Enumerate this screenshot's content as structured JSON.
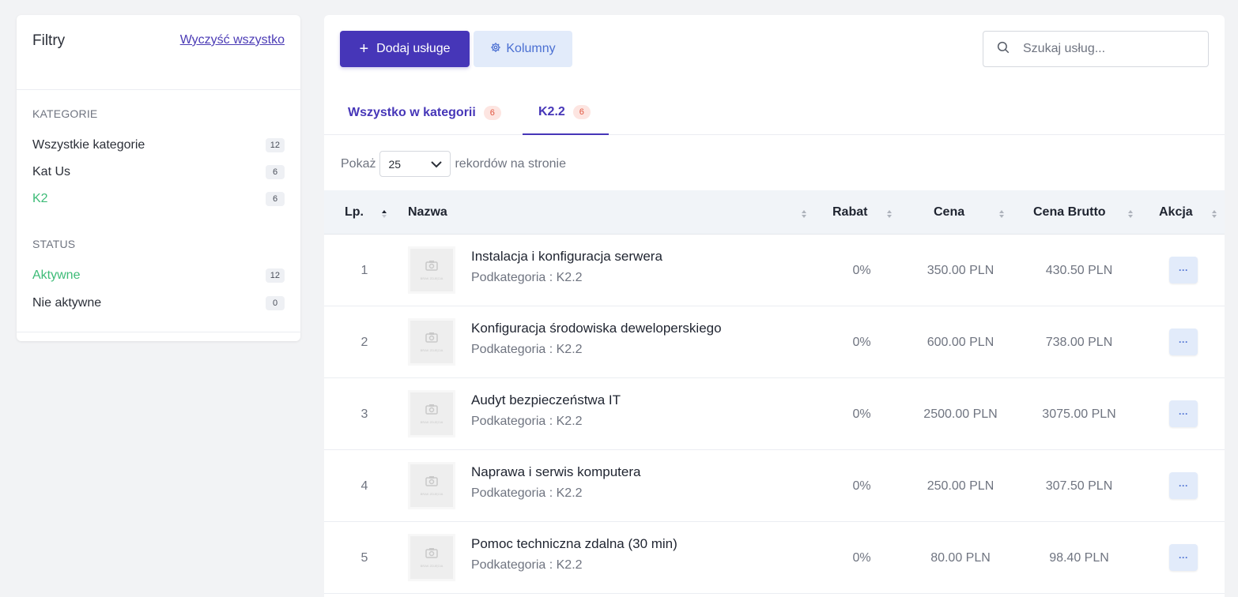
{
  "filters": {
    "title": "Filtry",
    "clear_all": "Wyczyść wszystko",
    "categories_label": "KATEGORIE",
    "categories": [
      {
        "label": "Wszystkie kategorie",
        "count": "12"
      },
      {
        "label": "Kat Us",
        "count": "6"
      },
      {
        "label": "K2",
        "count": "6"
      }
    ],
    "status_label": "STATUS",
    "statuses": [
      {
        "label": "Aktywne",
        "count": "12"
      },
      {
        "label": "Nie aktywne",
        "count": "0"
      }
    ]
  },
  "toolbar": {
    "add_label": "Dodaj usługe",
    "columns_label": "Kolumny",
    "search_placeholder": "Szukaj usług..."
  },
  "tabs": [
    {
      "label": "Wszystko w kategorii",
      "count": "6"
    },
    {
      "label": "K2.2",
      "count": "6"
    }
  ],
  "pager": {
    "prefix": "Pokaż",
    "value": "25",
    "suffix": "rekordów na stronie"
  },
  "table": {
    "headers": {
      "lp": "Lp.",
      "name": "Nazwa",
      "rabat": "Rabat",
      "cena": "Cena",
      "brutto": "Cena Brutto",
      "akcja": "Akcja"
    },
    "thumb_text": "BRAK ZDJĘCIA",
    "rows": [
      {
        "num": "1",
        "name": "Instalacja i konfiguracja serwera",
        "sub": "Podkategoria : K2.2",
        "rabat": "0%",
        "cena": "350.00 PLN",
        "brutto": "430.50 PLN"
      },
      {
        "num": "2",
        "name": "Konfiguracja środowiska deweloperskiego",
        "sub": "Podkategoria : K2.2",
        "rabat": "0%",
        "cena": "600.00 PLN",
        "brutto": "738.00 PLN"
      },
      {
        "num": "3",
        "name": "Audyt bezpieczeństwa IT",
        "sub": "Podkategoria : K2.2",
        "rabat": "0%",
        "cena": "2500.00 PLN",
        "brutto": "3075.00 PLN"
      },
      {
        "num": "4",
        "name": "Naprawa i serwis komputera",
        "sub": "Podkategoria : K2.2",
        "rabat": "0%",
        "cena": "250.00 PLN",
        "brutto": "307.50 PLN"
      },
      {
        "num": "5",
        "name": "Pomoc techniczna zdalna (30 min)",
        "sub": "Podkategoria : K2.2",
        "rabat": "0%",
        "cena": "80.00 PLN",
        "brutto": "98.40 PLN"
      }
    ],
    "action_label": "···"
  },
  "colors": {
    "primary": "#4636b8",
    "active_green": "#3dbb77",
    "badge_red": "#e0553f",
    "light_blue": "#e2ebfa"
  }
}
